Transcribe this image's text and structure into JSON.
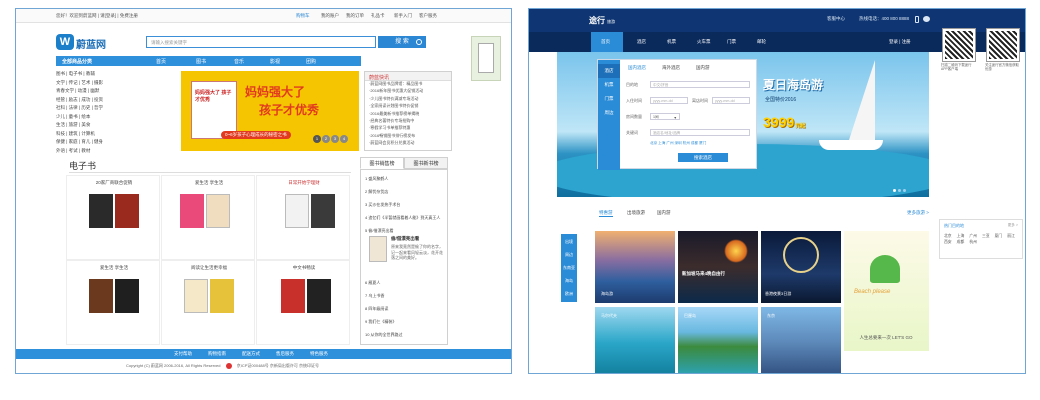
{
  "left_site": {
    "topbar": {
      "welcome": "您好！欢迎到蔚蓝网 | 请[登录] | 免费注册",
      "links": [
        "购物车",
        "我的账户",
        "我的订单",
        "礼品卡",
        "新手入门",
        "客户服务"
      ]
    },
    "logo": {
      "glyph": "W",
      "name": "蔚蓝网"
    },
    "search": {
      "placeholder": "请输入搜索关键字",
      "button": "搜 索"
    },
    "nav": [
      "全部商品分类",
      "首页",
      "图书",
      "音乐",
      "影视",
      "团购"
    ],
    "categories": [
      "图书 | 电子书 | 教辅",
      "文学 | 传记 | 艺术 | 摄影",
      "青春文学 | 动漫 | 幽默",
      "经管 | 励志 | 成功 | 投资",
      "社科 | 法律 | 历史 | 哲学",
      "少儿 | 童书 | 绘本",
      "生活 | 旅游 | 美食",
      "科技 | 建筑 | 计算机",
      "保健 | 家庭 | 育儿 | 健身",
      "外语 | 考试 | 教材"
    ],
    "banner": {
      "line1": "妈妈强大了",
      "line2": "孩子才优秀",
      "badge": "0~6岁孩子心理成长的秘密之书",
      "book_title": "妈妈强大了 孩子才优秀",
      "pages": [
        "1",
        "2",
        "3",
        "4"
      ]
    },
    "news": {
      "title": "蔚蓝快讯",
      "items": [
        "·蔚蓝网图书品牌馆：精品图书",
        "·2016新年图书优惠大促销活动",
        "·少儿图书特价满减专场活动",
        "·全家阅读计划图书特价促销",
        "·2016最美新书推荐榜单揭晓",
        "·经典名著特价专场抢购中",
        "·寒假学习书单推荐特惠",
        "·2016畅销图书排行榜发布",
        "·蔚蓝网会员积分兑换活动"
      ]
    },
    "ebook": {
      "title": "电子书",
      "cells": [
        {
          "title": "20家厂商联合促销"
        },
        {
          "title": "爱生活 享生活"
        },
        {
          "title": "日常开始学理财"
        },
        {
          "title": "爱生活 享生活"
        },
        {
          "title": "阅读让生活更幸福"
        },
        {
          "title": "中文书畅读"
        }
      ]
    },
    "ranking": {
      "tabs": [
        "图书销售榜",
        "图书新书榜"
      ],
      "items": [
        "1 盛风聚鹤人",
        "2 解忧杂货店",
        "3 买沙在发热手术台",
        "4 追忆们《半暂就画看着人能》到天真王人",
        "5 偷/借漂亮出看",
        "6 雁夏人",
        "7 乌上书香",
        "8 四年级阅读",
        "9 我们仨《精装》",
        "10 从你的全世界路过"
      ],
      "featured_title": "偷/借漂亮出看",
      "featured_desc": "原来我竟然是偷了你的名字，记一起来看风轻云淡，花开花落之间的美好。"
    },
    "footer": {
      "nav": [
        "支付帮助",
        "购物指南",
        "配送方式",
        "售后服务",
        "特色服务"
      ],
      "copyright": "Copyright (C) 蔚蓝网 2006-2016, All Rights Reserved",
      "license": "京ICP证000488号 京新局出版许可 京统印证号"
    }
  },
  "right_site": {
    "header": {
      "logo": "途行",
      "logo_sub": "旅游",
      "links": [
        "客服中心",
        "热线电话：400 800 8888"
      ],
      "login": "登录 | 注册"
    },
    "nav": [
      "首页",
      "酒店",
      "机票",
      "火车票",
      "门票",
      "邮轮"
    ],
    "hero": {
      "headline": "夏日海岛游",
      "sub": "全国特价2016",
      "price": "3999",
      "unit": "元起"
    },
    "booking": {
      "side_tabs": [
        "酒店",
        "机票",
        "门票",
        "周边"
      ],
      "tabs": [
        "国内酒店",
        "海外酒店",
        "国内游"
      ],
      "fields": [
        {
          "label": "目的地",
          "value": "",
          "placeholder": "中文/拼音"
        },
        {
          "label": "入住时间",
          "value": "",
          "placeholder": "yyyy-mm-dd"
        },
        {
          "label": "离店时间",
          "value": "",
          "placeholder": "yyyy-mm-dd"
        },
        {
          "label": "房间数量",
          "value": "1间",
          "placeholder": ""
        },
        {
          "label": "关键词",
          "value": "",
          "placeholder": "酒店名/地址/品牌"
        }
      ],
      "hints": "北京  上海  广州  深圳  杭州  成都  厦门",
      "submit": "搜索酒店"
    },
    "qr_codes": [
      {
        "caption": "扫描二维码下载途行APP客户端"
      },
      {
        "caption": "关注途行官方微信获取优惠"
      }
    ],
    "section_tabs": [
      "特惠游",
      "出境旅游",
      "国内游"
    ],
    "more": "更多旅游 >",
    "left_rail": [
      "出境",
      "周边",
      "东南亚",
      "海岛",
      "欧洲"
    ],
    "photos": [
      {
        "caption": "海岛游"
      },
      {
        "caption": "新加坡马来4晚自由行"
      },
      {
        "caption": "香港夜景3日游"
      },
      {
        "caption": "Beach please"
      },
      {
        "caption": "马尔代夫"
      },
      {
        "caption": "巴厘岛"
      },
      {
        "caption": "东京"
      },
      {
        "caption": "人生总要来一次 LET'S GO"
      }
    ],
    "side_widget": {
      "title": "热门目的地",
      "more": "更多 >",
      "cities": [
        "北京",
        "上海",
        "广州",
        "三亚",
        "厦门",
        "丽江",
        "西安",
        "成都",
        "杭州"
      ]
    }
  }
}
